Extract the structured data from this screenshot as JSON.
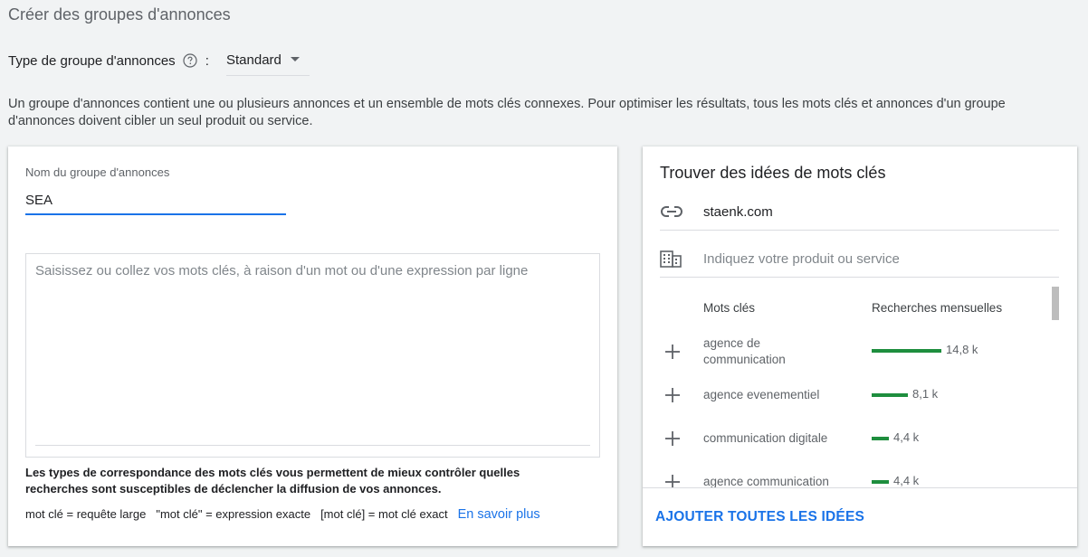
{
  "page": {
    "title": "Créer des groupes d'annonces"
  },
  "ad_group_type": {
    "label": "Type de groupe d'annonces",
    "colon": ":",
    "value": "Standard"
  },
  "intro_text": "Un groupe d'annonces contient une ou plusieurs annonces et un ensemble de mots clés connexes. Pour optimiser les résultats, tous les mots clés et annonces d'un groupe d'annonces doivent cibler un seul produit ou service.",
  "ad_group_form": {
    "name_label": "Nom du groupe d'annonces",
    "name_value": "SEA",
    "keywords_placeholder": "Saisissez ou collez vos mots clés, à raison d'un mot ou d'une expression par ligne",
    "match_note": "Les types de correspondance des mots clés vous permettent de mieux contrôler quelles recherches sont susceptibles de déclencher la diffusion de vos annonces.",
    "match_types": [
      "mot clé = requête large",
      "\"mot clé\" = expression exacte",
      "[mot clé] = mot clé exact"
    ],
    "learn_more": "En savoir plus"
  },
  "keyword_ideas": {
    "title": "Trouver des idées de mots clés",
    "url": "staenk.com",
    "product_placeholder": "Indiquez votre produit ou service",
    "col_keywords": "Mots clés",
    "col_monthly": "Recherches mensuelles",
    "items": [
      {
        "keyword": "agence de communication",
        "volume": "14,8 k",
        "volume_fraction": 1.0
      },
      {
        "keyword": "agence evenementiel",
        "volume": "8,1 k",
        "volume_fraction": 0.52
      },
      {
        "keyword": "communication digitale",
        "volume": "4,4 k",
        "volume_fraction": 0.25
      },
      {
        "keyword": "agence communication",
        "volume": "4,4 k",
        "volume_fraction": 0.25
      }
    ],
    "add_all": "AJOUTER TOUTES LES IDÉES"
  },
  "colors": {
    "accent": "#1a73e8",
    "bar_green": "#1e8e3e"
  },
  "icons": {
    "help": "help-circle-icon",
    "dropdown": "caret-down-icon",
    "link": "link-icon",
    "building": "building-icon",
    "add": "plus-icon"
  }
}
